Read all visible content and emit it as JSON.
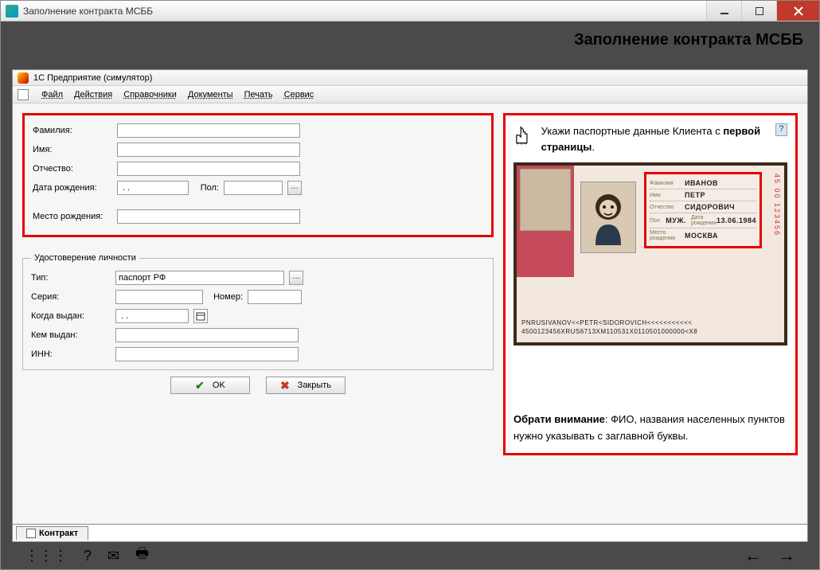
{
  "window": {
    "title": "Заполнение контракта МСББ"
  },
  "header": {
    "heading": "Заполнение контракта МСББ"
  },
  "app": {
    "title": "1С Предприятие (симулятор)",
    "menu": [
      "Файл",
      "Действия",
      "Справочники",
      "Документы",
      "Печать",
      "Сервис"
    ]
  },
  "form": {
    "surname_label": "Фамилия:",
    "name_label": "Имя:",
    "patronymic_label": "Отчество:",
    "dob_label": "Дата рождения:",
    "dob_value": " . .",
    "gender_label": "Пол:",
    "gender_value": "",
    "birthplace_label": "Место рождения:"
  },
  "identity": {
    "legend": "Удостоверение личности",
    "type_label": "Тип:",
    "type_value": "паспорт РФ",
    "series_label": "Серия:",
    "number_label": "Номер:",
    "issued_when_label": "Когда выдан:",
    "issued_when_value": " . .",
    "issued_by_label": "Кем выдан:",
    "inn_label": "ИНН:"
  },
  "actions": {
    "ok": "OK",
    "close": "Закрыть"
  },
  "hint": {
    "line1": "Укажи паспортные данные Клиента с ",
    "line1_bold": "первой страницы",
    "note_bold": "Обрати внимание",
    "note_rest": ": ФИО, названия населенных пунктов нужно указывать с заглавной буквы."
  },
  "passport": {
    "labels": {
      "surname": "Фамилия",
      "name": "Имя",
      "patronymic": "Отчество",
      "sex": "Пол",
      "dob": "Дата рождения",
      "birthplace": "Место рождения"
    },
    "surname": "ИВАНОВ",
    "name": "ПЕТР",
    "patronymic": "СИДОРОВИЧ",
    "sex": "МУЖ.",
    "dob": "13.06.1984",
    "birthplace": "МОСКВА",
    "side": "45 00 123456",
    "mrz1": "PNRUSIVANOV<<PETR<SIDOROVICH<<<<<<<<<<<",
    "mrz2": "4500123456XRUS6713XM110531X0110501000000<X8"
  },
  "tab": {
    "label": "Контракт"
  }
}
